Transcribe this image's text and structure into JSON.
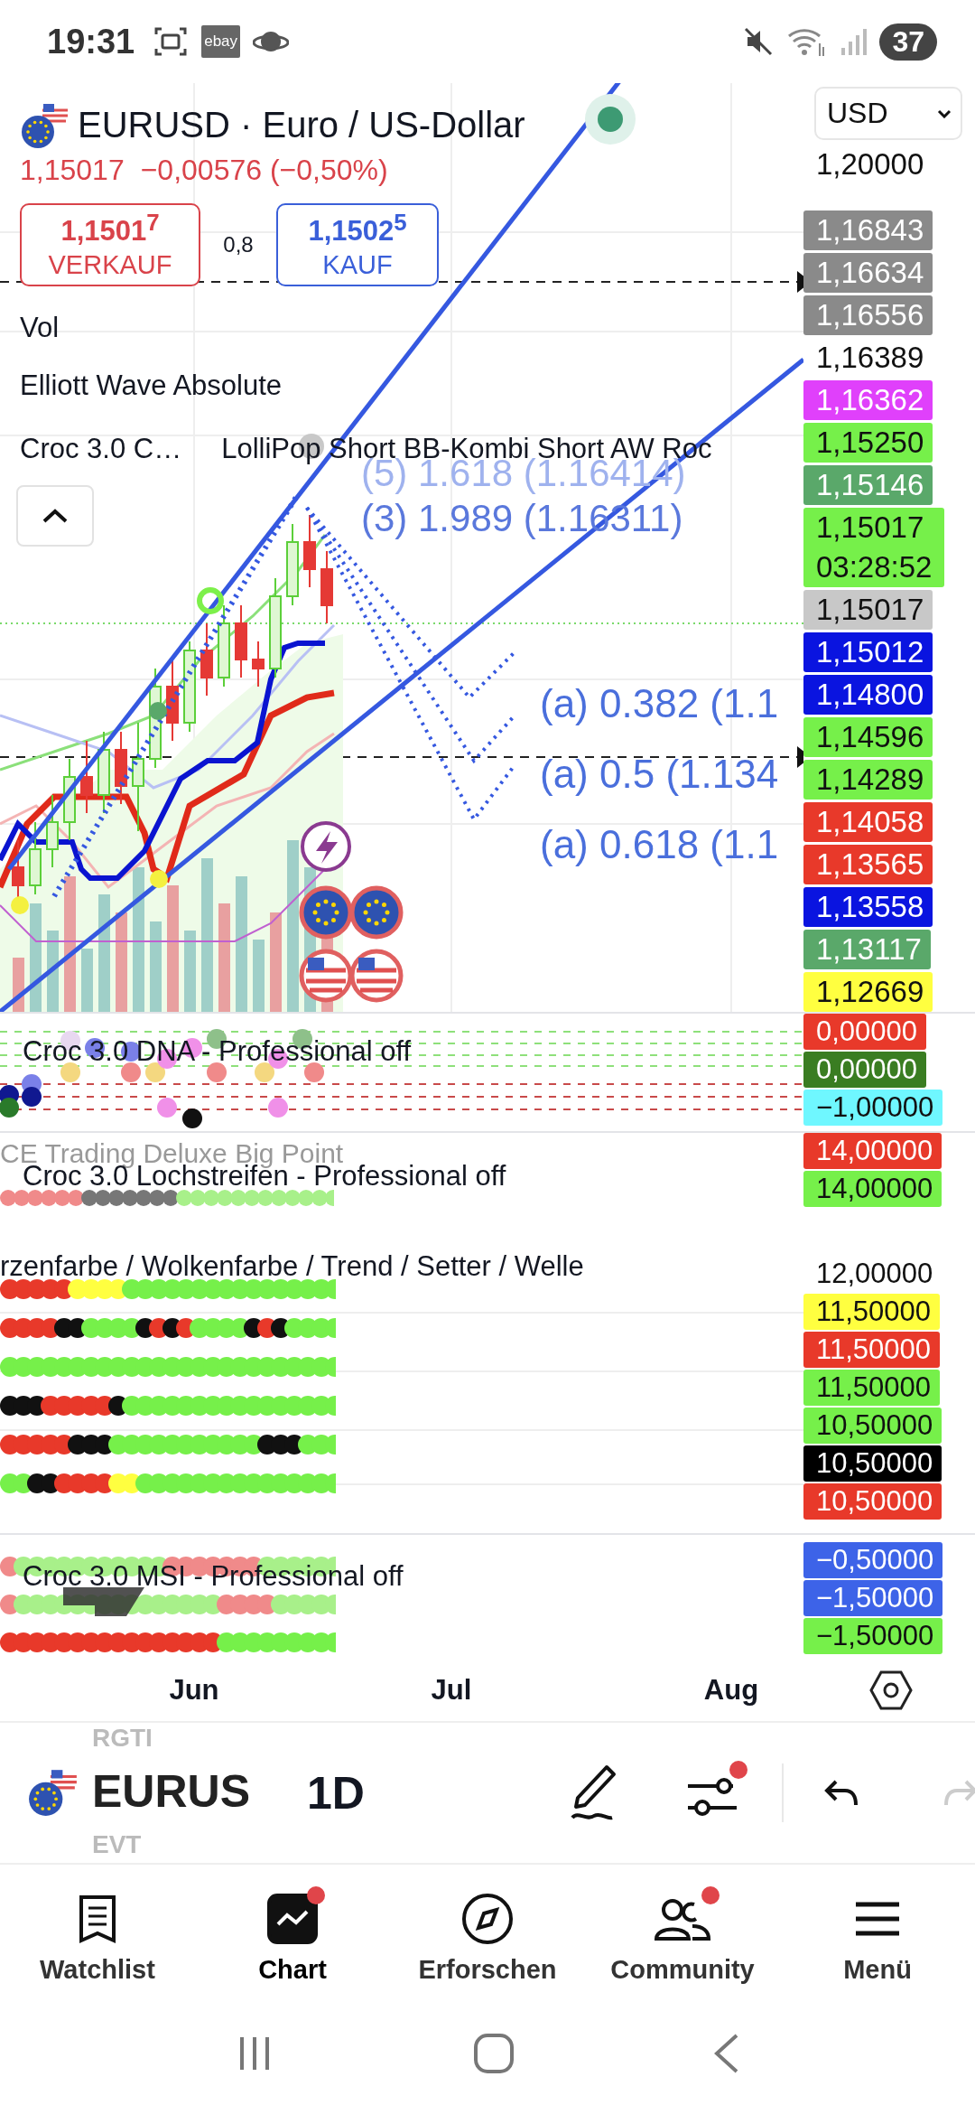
{
  "status_bar": {
    "time": "19:31",
    "ebay_label": "ebay",
    "battery": "37"
  },
  "symbol": {
    "title": "EURUSD · Euro / US-Dollar",
    "last": "1,15017",
    "change": "−0,00576 (−0,50%)",
    "sell": {
      "price": "1,1501$^{7}$",
      "label": "VERKAUF"
    },
    "spread": "0,8",
    "buy": {
      "price": "1,1502$^{5}$",
      "label": "KAUF"
    }
  },
  "currency_select": {
    "value": "USD"
  },
  "main_pane": {
    "legends": [
      "Vol",
      "Elliott Wave Absolute"
    ],
    "legend_row": [
      "Croc 3.0 C…",
      "LolliPop Short BB-Kombi Short AW Roc"
    ],
    "wave_labels": [
      "(5) 1.618 (1.16414)",
      "(3) 1.989 (1.16311)"
    ],
    "fib_labels": [
      "(a) 0.382 (1.1",
      "(a) 0.5 (1.134",
      "(a) 0.618 (1.1"
    ],
    "price_labels": [
      {
        "kind": "plain",
        "text": "1,20000"
      },
      {
        "kind": "tag",
        "text": "1,16843",
        "color": "#8a8a8a"
      },
      {
        "kind": "tag",
        "text": "1,16634",
        "color": "#8a8a8a"
      },
      {
        "kind": "tag",
        "text": "1,16556",
        "color": "#8a8a8a"
      },
      {
        "kind": "plain",
        "text": "1,16389"
      },
      {
        "kind": "tag",
        "text": "1,16362",
        "color": "#e040fb"
      },
      {
        "kind": "tag",
        "text": "1,15250",
        "color": "#76f04a"
      },
      {
        "kind": "tag",
        "text": "1,15146",
        "color": "#5aa86a"
      },
      {
        "kind": "tag",
        "text": "1,15017",
        "countdown": "03:28:52",
        "color": "#76f04a"
      },
      {
        "kind": "tag",
        "text": "1,15017",
        "color": "#c8c8c8"
      },
      {
        "kind": "tag",
        "text": "1,15012",
        "color": "#0a14e0"
      },
      {
        "kind": "tag",
        "text": "1,14800",
        "color": "#0a14e0"
      },
      {
        "kind": "tag",
        "text": "1,14596",
        "color": "#76f04a"
      },
      {
        "kind": "tag",
        "text": "1,14289",
        "color": "#76f04a"
      },
      {
        "kind": "tag",
        "text": "1,14058",
        "color": "#e8392a"
      },
      {
        "kind": "tag",
        "text": "1,13565",
        "color": "#e8392a"
      },
      {
        "kind": "tag",
        "text": "1,13558",
        "color": "#0a14e0"
      },
      {
        "kind": "tag",
        "text": "1,13117",
        "color": "#5aa86a"
      },
      {
        "kind": "tag",
        "text": "1,12669",
        "color": "#ffff40"
      }
    ]
  },
  "panes": [
    {
      "kind": "dna",
      "legends": [
        {
          "kind": "title",
          "text": "Croc 3.0 DNA - Professional off"
        }
      ],
      "price_labels": [
        {
          "kind": "tag",
          "text": "0,00000",
          "color": "#e8392a"
        },
        {
          "kind": "tag",
          "text": "0,00000",
          "color": "#3a7d22"
        },
        {
          "kind": "tag",
          "text": "−1,00000",
          "color": "#6ff7ff"
        }
      ]
    },
    {
      "kind": "stripe",
      "legends": [
        {
          "kind": "muted",
          "text": "CE Trading Deluxe Big Point"
        },
        {
          "kind": "title",
          "text": "Croc 3.0 Lochstreifen - Professional off"
        }
      ],
      "price_labels": [
        {
          "kind": "tag",
          "text": "14,00000",
          "color": "#e8392a"
        },
        {
          "kind": "tag",
          "text": "14,00000",
          "color": "#76f04a"
        }
      ]
    },
    {
      "kind": "rows",
      "legends": [
        {
          "kind": "title",
          "text": "rzenfarbe / Wolkenfarbe / Trend / Setter / Welle"
        }
      ],
      "price_labels": [
        {
          "kind": "plain",
          "text": "12,00000"
        },
        {
          "kind": "tag",
          "text": "11,50000",
          "color": "#ffff40"
        },
        {
          "kind": "tag",
          "text": "11,50000",
          "color": "#e8392a"
        },
        {
          "kind": "tag",
          "text": "11,50000",
          "color": "#76f04a"
        },
        {
          "kind": "tag",
          "text": "10,50000",
          "color": "#76f04a"
        },
        {
          "kind": "tag",
          "text": "10,50000",
          "color": "#000000"
        },
        {
          "kind": "tag",
          "text": "10,50000",
          "color": "#e8392a"
        }
      ]
    },
    {
      "kind": "msi",
      "legends": [
        {
          "kind": "title",
          "text": "Croc 3.0 MSI - Professional off"
        }
      ],
      "price_labels": [
        {
          "kind": "tag",
          "text": "−0,50000",
          "color": "#3d63e8"
        },
        {
          "kind": "tag",
          "text": "−1,50000",
          "color": "#3d63e8"
        },
        {
          "kind": "tag",
          "text": "−1,50000",
          "color": "#76f04a"
        }
      ]
    }
  ],
  "time_axis": [
    "Jun",
    "Jul",
    "Aug"
  ],
  "toolbar": {
    "prev_symbol": "RGTI",
    "symbol": "EURUS",
    "next_symbol": "EVT",
    "interval": "1D",
    "indicator_badge": true
  },
  "bottom_nav": [
    {
      "label": "Watchlist",
      "selected": false,
      "badge": false
    },
    {
      "label": "Chart",
      "selected": true,
      "badge": true
    },
    {
      "label": "Erforschen",
      "selected": false,
      "badge": false
    },
    {
      "label": "Community",
      "selected": false,
      "badge": true
    },
    {
      "label": "Menü",
      "selected": false,
      "badge": false
    }
  ]
}
